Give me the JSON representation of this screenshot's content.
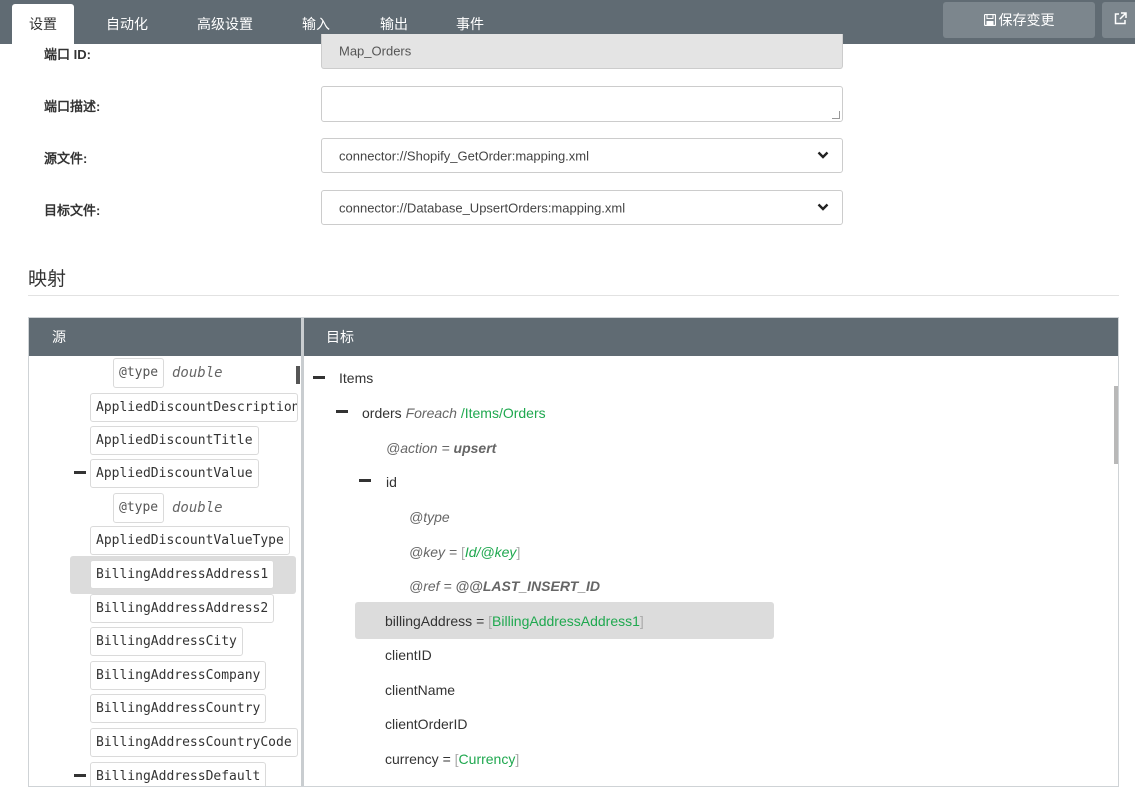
{
  "tabs": [
    "设置",
    "自动化",
    "高级设置",
    "输入",
    "输出",
    "事件"
  ],
  "header": {
    "save_label": "保存变更",
    "save_icon": "save-icon",
    "open_icon": "external-link-icon"
  },
  "form": {
    "port_id_label": "端口 ID:",
    "port_id_value": "Map_Orders",
    "port_desc_label": "端口描述:",
    "port_desc_value": "",
    "source_label": "源文件:",
    "source_value": "connector://Shopify_GetOrder:mapping.xml",
    "target_label": "目标文件:",
    "target_value": "connector://Database_UpsertOrders:mapping.xml"
  },
  "mapping": {
    "title": "映射",
    "source_header": "源",
    "target_header": "目标",
    "source_nodes": [
      "AppliedDiscountDescription",
      "AppliedDiscountTitle",
      "AppliedDiscountValue",
      "AppliedDiscountValueType",
      "BillingAddressAddress1",
      "BillingAddressAddress2",
      "BillingAddressCity",
      "BillingAddressCompany",
      "BillingAddressCountry",
      "BillingAddressCountryCode",
      "BillingAddressDefault"
    ],
    "source_attrs": [
      {
        "name": "@type",
        "value": "double"
      },
      {
        "name": "@type",
        "value": "double"
      }
    ],
    "target": {
      "items": "Items",
      "orders": "orders",
      "foreach_kw": "Foreach",
      "foreach_path": "/Items/Orders",
      "action_attr": "@action",
      "action_value": "upsert",
      "id": "id",
      "type_attr": "@type",
      "key_attr": "@key",
      "key_value": "Id/@key",
      "ref_attr": "@ref",
      "ref_value": "@@LAST_INSERT_ID",
      "billing": "billingAddress",
      "billing_value": "BillingAddressAddress1",
      "client_id": "clientID",
      "client_name": "clientName",
      "client_order_id": "clientOrderID",
      "currency": "currency",
      "currency_value": "Currency",
      "eq": "=",
      "lb": "[",
      "rb": "]"
    }
  }
}
